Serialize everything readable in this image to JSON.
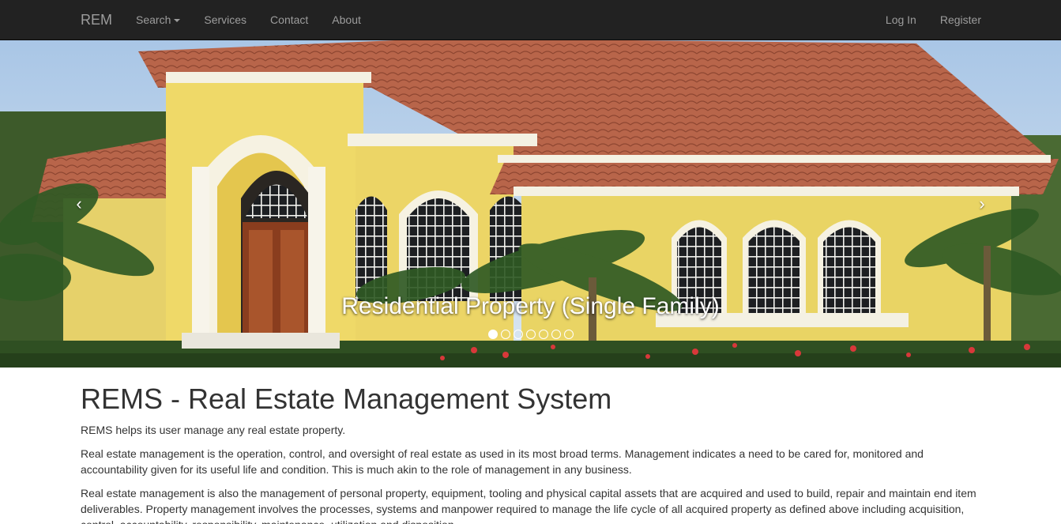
{
  "nav": {
    "brand": "REM",
    "left": [
      "Search",
      "Services",
      "Contact",
      "About"
    ],
    "right": [
      "Log In",
      "Register"
    ]
  },
  "carousel": {
    "caption": "Residential Property (Single Family)",
    "indicator_count": 7,
    "active_index": 0,
    "prev_glyph": "‹",
    "next_glyph": "›"
  },
  "main": {
    "title": "REMS - Real Estate Management System",
    "paragraphs": [
      "REMS helps its user manage any real estate property.",
      "Real estate management is the operation, control, and oversight of real estate as used in its most broad terms. Management indicates a need to be cared for, monitored and accountability given for its useful life and condition. This is much akin to the role of management in any business.",
      "Real estate management is also the management of personal property, equipment, tooling and physical capital assets that are acquired and used to build, repair and maintain end item deliverables. Property management involves the processes, systems and manpower required to manage the life cycle of all acquired property as defined above including acquisition, control, accountability, responsibility, maintenance, utilization and disposition."
    ]
  }
}
